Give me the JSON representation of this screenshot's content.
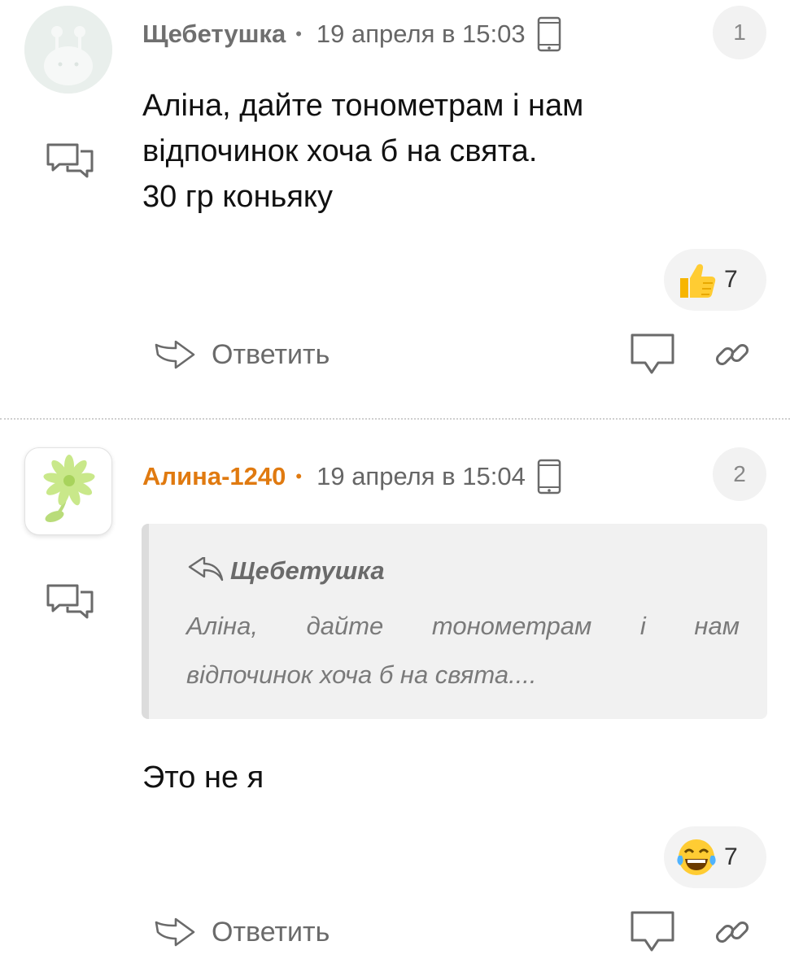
{
  "comments": [
    {
      "author": "Щебетушка",
      "date": "19 апреля в 15:03",
      "number": "1",
      "text_lines": [
        "Аліна, дайте тонометрам і нам",
        "відпочинок хоча б на свята.",
        "30 гр коньяку"
      ],
      "reaction": {
        "emoji": "thumbs-up-icon",
        "count": "7"
      },
      "reply_label": "Ответить"
    },
    {
      "author": "Алина-1240",
      "date": "19 апреля в 15:04",
      "number": "2",
      "quote": {
        "author": "Щебетушка",
        "line1_words": [
          "Аліна,",
          "дайте",
          "тонометрам",
          "і",
          "нам"
        ],
        "line2": "відпочинок хоча б на свята...."
      },
      "text_lines": [
        "Это не я"
      ],
      "reaction": {
        "emoji": "tears-of-joy-icon",
        "count": "7"
      },
      "reply_label": "Ответить"
    }
  ],
  "colors": {
    "author_gray": "#6f6f6f",
    "author_orange": "#e07a10",
    "icon_gray": "#6a6a6a",
    "badge_bg": "#f2f2f2",
    "quote_bg": "#f1f1f1"
  }
}
